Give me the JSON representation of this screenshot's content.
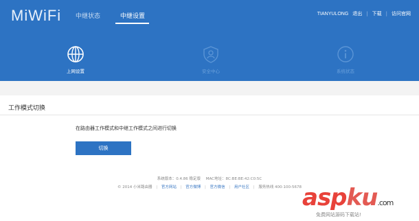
{
  "header": {
    "logo": "MiWiFi",
    "tabs": [
      {
        "label": "中继状态",
        "active": false
      },
      {
        "label": "中继设置",
        "active": true
      }
    ],
    "user": "TIANYULONG",
    "links": [
      "退出",
      "下载",
      "访问官网"
    ]
  },
  "functions": [
    {
      "label": "上网设置",
      "icon": "globe-icon",
      "active": true
    },
    {
      "label": "安全中心",
      "icon": "shield-user-icon",
      "active": false
    },
    {
      "label": "系统状态",
      "icon": "info-icon",
      "active": false
    }
  ],
  "panel": {
    "title": "工作模式切换",
    "description": "在路由器工作模式和中继工作模式之间进行切换",
    "button": "切换"
  },
  "footer": {
    "version_label": "系统版本：0.4.86 稳定版",
    "mac_label": "MAC地址：8C:BE:BE:42:C0:5C",
    "copyright": "© 2014 小米路由器",
    "links": [
      "官方网站",
      "官方微博",
      "官方微信",
      "用户社区"
    ],
    "service": "服务热线 400-100-5678"
  },
  "watermark": {
    "main_a": "asp",
    "main_b": "ku",
    "main_c": ".com",
    "sub": "免费网站源码下载站!"
  },
  "colors": {
    "header_bg": "#2d73c3",
    "button_bg": "#2d73c3",
    "watermark": "#e8423a"
  }
}
